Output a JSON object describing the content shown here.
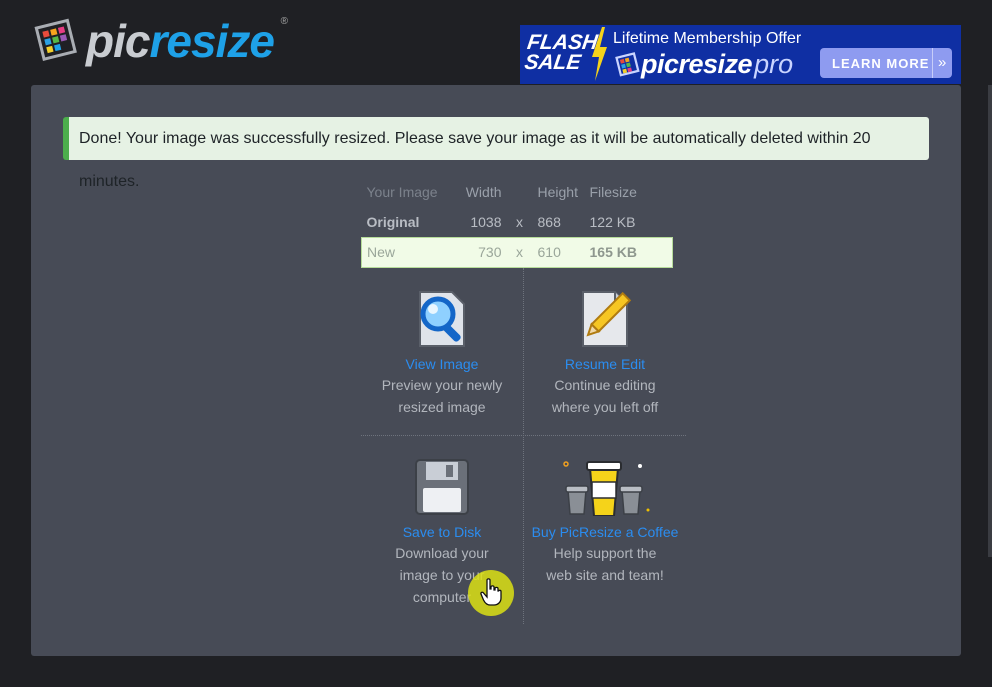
{
  "header": {
    "logo": {
      "part1": "pic",
      "part2": "resize",
      "reg": "®",
      "icon": "photo-grid-logo-icon"
    },
    "banner": {
      "flash_line1": "FLASH",
      "flash_line2": "SALE",
      "offer": "Lifetime Membership Offer",
      "brand": "picresize",
      "brand_suffix": "pro",
      "cta": "LEARN MORE",
      "cta_arrow": "»",
      "bg_color": "#0f2fa3"
    }
  },
  "alert": {
    "message": "Done! Your image was successfully resized. Please save your image as it will be automatically deleted within 20 minutes.",
    "accent": "#4cae4c"
  },
  "size_table": {
    "headers": [
      "Your Image",
      "Width",
      "",
      "Height",
      "Filesize"
    ],
    "rows": [
      {
        "label": "Original",
        "width": "1038",
        "sep": "x",
        "height": "868",
        "filesize": "122 KB"
      },
      {
        "label": "New",
        "width": "730",
        "sep": "x",
        "height": "610",
        "filesize": "165 KB"
      }
    ]
  },
  "actions": [
    {
      "title": "View Image",
      "desc": "Preview your newly resized image",
      "icon": "magnifier-icon"
    },
    {
      "title": "Resume Edit",
      "desc": "Continue editing where you left off",
      "icon": "pencil-document-icon"
    },
    {
      "title": "Save to Disk",
      "desc": "Download your image to your computer",
      "icon": "floppy-disk-icon"
    },
    {
      "title": "Buy PicResize a Coffee",
      "desc": "Help support the web site and team!",
      "icon": "coffee-cups-icon"
    }
  ],
  "colors": {
    "link": "#2b8df0",
    "card_bg": "#474b56",
    "page_bg": "#1f2024"
  }
}
